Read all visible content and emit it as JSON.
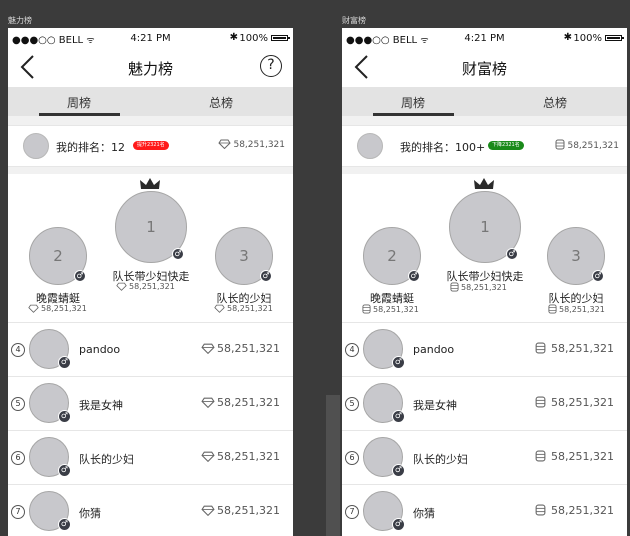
{
  "screens": [
    {
      "artboard_label": "魅力榜",
      "status": {
        "carrier": "●●●○○ BELL",
        "wifi": "ᯤ",
        "time": "4:21 PM",
        "battery": "100%"
      },
      "nav_title": "魅力榜",
      "help": "?",
      "tabs": [
        "周榜",
        "总榜"
      ],
      "my_rank": {
        "label": "我的排名：12",
        "badge": "提升2321名",
        "badge_color": "#ff1a1a",
        "score": "58,251,321",
        "icon": "diamond-icon"
      },
      "podium": [
        {
          "rank": "1",
          "name": "队长带少妇快走",
          "score": "58,251,321"
        },
        {
          "rank": "2",
          "name": "晚霞蜻蜓",
          "score": "58,251,321"
        },
        {
          "rank": "3",
          "name": "队长的少妇",
          "score": "58,251,321"
        }
      ],
      "list": [
        {
          "rank": "4",
          "name": "pandoo",
          "score": "58,251,321"
        },
        {
          "rank": "5",
          "name": "我是女神",
          "score": "58,251,321"
        },
        {
          "rank": "6",
          "name": "队长的少妇",
          "score": "58,251,321"
        },
        {
          "rank": "7",
          "name": "你猜",
          "score": "58,251,321"
        }
      ]
    },
    {
      "artboard_label": "财富榜",
      "status": {
        "carrier": "●●●○○ BELL",
        "wifi": "ᯤ",
        "time": "4:21 PM",
        "battery": "100%"
      },
      "nav_title": "财富榜",
      "tabs": [
        "周榜",
        "总榜"
      ],
      "my_rank": {
        "label": "我的排名：100+",
        "badge": "下降2321名",
        "badge_color": "#1a8a1a",
        "score": "58,251,321",
        "icon": "coin-stack-icon"
      },
      "podium": [
        {
          "rank": "1",
          "name": "队长带少妇快走",
          "score": "58,251,321"
        },
        {
          "rank": "2",
          "name": "晚霞蜻蜓",
          "score": "58,251,321"
        },
        {
          "rank": "3",
          "name": "队长的少妇",
          "score": "58,251,321"
        }
      ],
      "list": [
        {
          "rank": "4",
          "name": "pandoo",
          "score": "58,251,321"
        },
        {
          "rank": "5",
          "name": "我是女神",
          "score": "58,251,321"
        },
        {
          "rank": "6",
          "name": "队长的少妇",
          "score": "58,251,321"
        },
        {
          "rank": "7",
          "name": "你猜",
          "score": "58,251,321"
        }
      ]
    }
  ]
}
